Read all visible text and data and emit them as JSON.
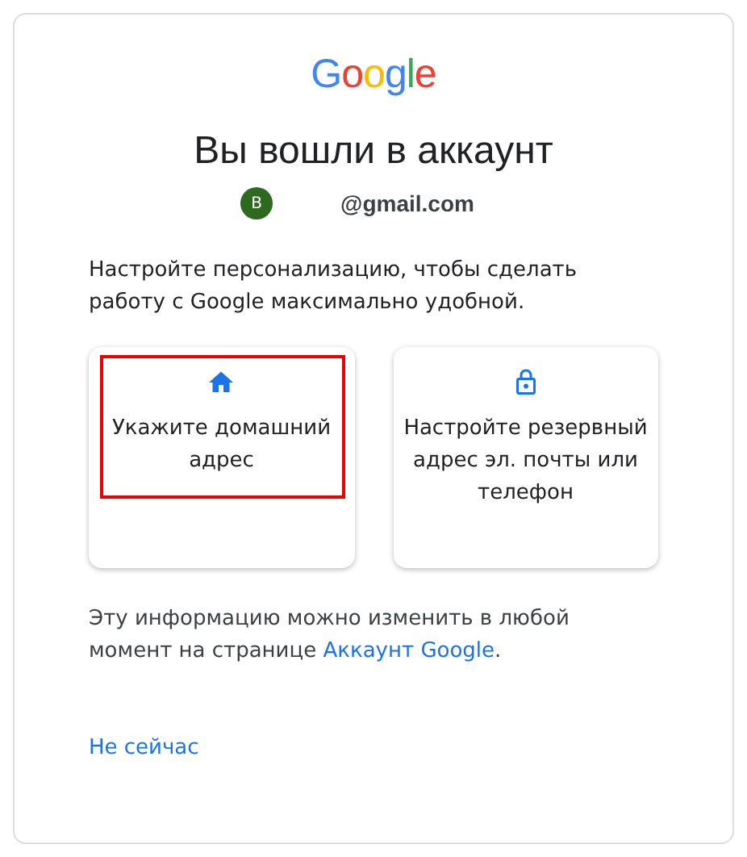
{
  "logo": "Google",
  "title": "Вы вошли в аккаунт",
  "account": {
    "avatar_letter": "B",
    "email": "@gmail.com"
  },
  "intro": "Настройте персонализацию, чтобы сделать работу с Google максимально удобной.",
  "cards": [
    {
      "kind": "home",
      "label": "Укажите домашний адрес",
      "highlighted": true
    },
    {
      "kind": "lock",
      "label": "Настройте резервный адрес эл. почты или телефон",
      "highlighted": false
    }
  ],
  "info": {
    "text": "Эту информацию можно изменить в любой момент на странице ",
    "link": "Аккаунт Google",
    "end": "."
  },
  "skip_link": "Не сейчас"
}
